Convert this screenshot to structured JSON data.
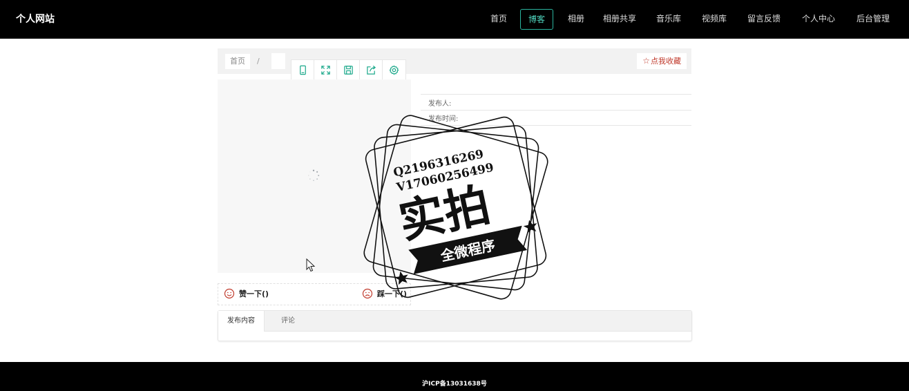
{
  "brand": "个人网站",
  "nav": {
    "items": [
      {
        "label": "首页"
      },
      {
        "label": "博客",
        "active": true
      },
      {
        "label": "相册"
      },
      {
        "label": "相册共享"
      },
      {
        "label": "音乐库"
      },
      {
        "label": "视频库"
      },
      {
        "label": "留言反馈"
      },
      {
        "label": "个人中心"
      },
      {
        "label": "后台管理"
      }
    ]
  },
  "breadcrumb": {
    "home": "首页",
    "separator": "/",
    "current": ""
  },
  "favorite": {
    "label": "点我收藏",
    "icon": "star-outline-icon"
  },
  "toolbar": {
    "icons": [
      "mobile-icon",
      "fullscreen-icon",
      "save-icon",
      "share-icon",
      "settings-icon"
    ],
    "accent": "#1aa88a"
  },
  "info": {
    "publisher_label": "发布人:",
    "time_label": "发布时间:"
  },
  "reactions": {
    "like_label": "赞一下()",
    "dislike_label": "踩一下()",
    "icon_color": "#c0392b"
  },
  "tabs": [
    {
      "label": "发布内容",
      "active": true
    },
    {
      "label": "评论"
    }
  ],
  "footer": {
    "icp": "沪ICP备13031638号"
  },
  "watermark": {
    "line1": "Q2196316269",
    "line2": "V17060256499",
    "big": "实拍",
    "banner": "全微程序"
  },
  "colors": {
    "nav_active": "#2bb5a0",
    "header_bg": "#000000",
    "favorite": "#c0392b"
  }
}
